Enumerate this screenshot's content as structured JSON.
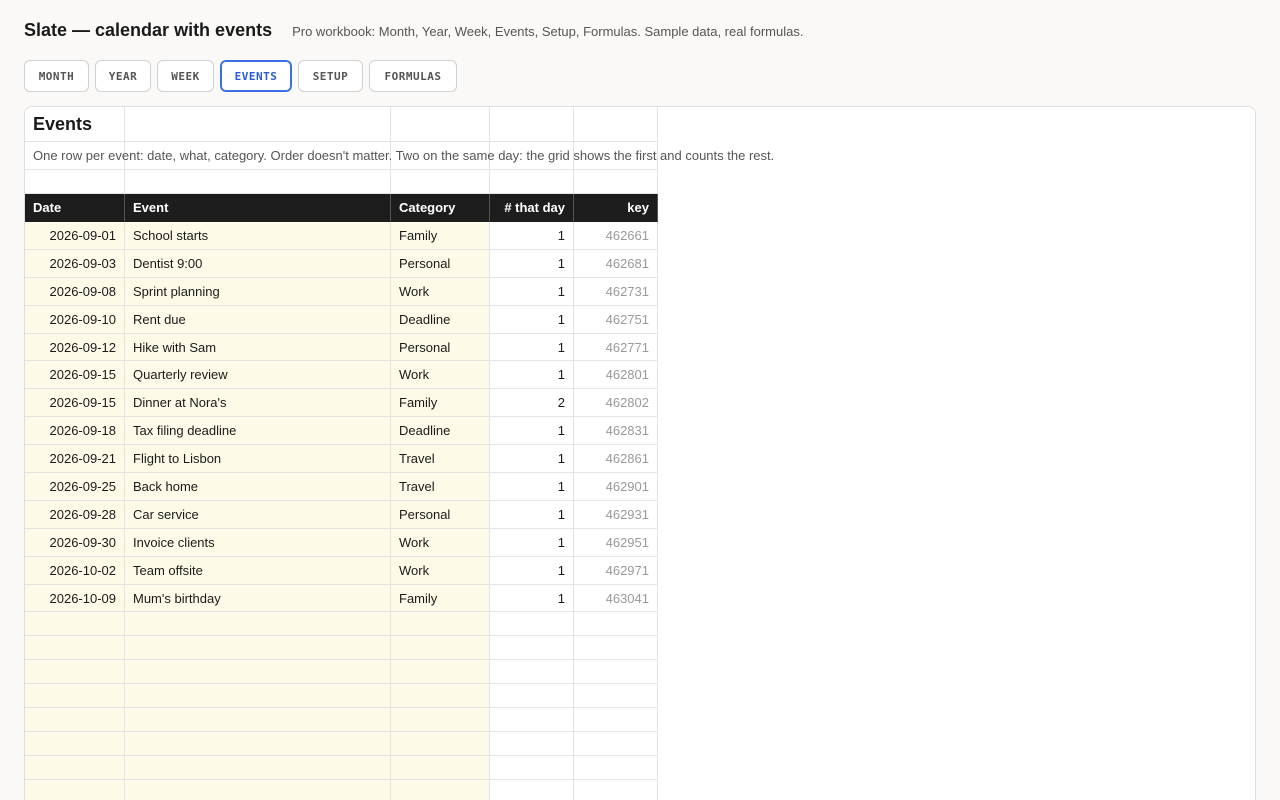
{
  "app": {
    "title": "Slate — calendar with events",
    "subtitle": "Pro workbook: Month, Year, Week, Events, Setup, Formulas. Sample data, real formulas."
  },
  "tabs": [
    {
      "label": "MONTH",
      "active": false
    },
    {
      "label": "YEAR",
      "active": false
    },
    {
      "label": "WEEK",
      "active": false
    },
    {
      "label": "EVENTS",
      "active": true
    },
    {
      "label": "SETUP",
      "active": false
    },
    {
      "label": "FORMULAS",
      "active": false
    }
  ],
  "sheet": {
    "title": "Events",
    "description": "One row per event: date, what, category. Order doesn't matter. Two on the same day: the grid shows the first and counts the rest.",
    "columns": [
      "Date",
      "Event",
      "Category",
      "# that day",
      "key"
    ],
    "rows": [
      [
        "2026-09-01",
        "School starts",
        "Family",
        "1",
        "462661"
      ],
      [
        "2026-09-03",
        "Dentist 9:00",
        "Personal",
        "1",
        "462681"
      ],
      [
        "2026-09-08",
        "Sprint planning",
        "Work",
        "1",
        "462731"
      ],
      [
        "2026-09-10",
        "Rent due",
        "Deadline",
        "1",
        "462751"
      ],
      [
        "2026-09-12",
        "Hike with Sam",
        "Personal",
        "1",
        "462771"
      ],
      [
        "2026-09-15",
        "Quarterly review",
        "Work",
        "1",
        "462801"
      ],
      [
        "2026-09-15",
        "Dinner at Nora's",
        "Family",
        "2",
        "462802"
      ],
      [
        "2026-09-18",
        "Tax filing deadline",
        "Deadline",
        "1",
        "462831"
      ],
      [
        "2026-09-21",
        "Flight to Lisbon",
        "Travel",
        "1",
        "462861"
      ],
      [
        "2026-09-25",
        "Back home",
        "Travel",
        "1",
        "462901"
      ],
      [
        "2026-09-28",
        "Car service",
        "Personal",
        "1",
        "462931"
      ],
      [
        "2026-09-30",
        "Invoice clients",
        "Work",
        "1",
        "462951"
      ],
      [
        "2026-10-02",
        "Team offsite",
        "Work",
        "1",
        "462971"
      ],
      [
        "2026-10-09",
        "Mum's birthday",
        "Family",
        "1",
        "463041"
      ]
    ]
  }
}
